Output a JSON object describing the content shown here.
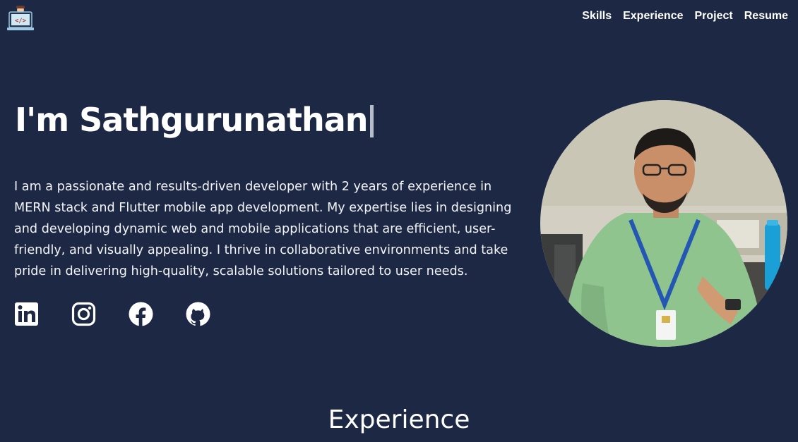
{
  "nav": {
    "items": [
      {
        "label": "Skills"
      },
      {
        "label": "Experience"
      },
      {
        "label": "Project"
      },
      {
        "label": "Resume"
      }
    ]
  },
  "hero": {
    "title": "I'm Sathgurunathan",
    "intro": "I am a passionate and results-driven developer with 2 years of experience in MERN stack and Flutter mobile app development. My expertise lies in designing and developing dynamic web and mobile applications that are efficient, user-friendly, and visually appealing. I thrive in collaborative environments and take pride in delivering high-quality, scalable solutions tailored to user needs."
  },
  "socials": [
    {
      "icon": "linkedin-icon"
    },
    {
      "icon": "instagram-icon"
    },
    {
      "icon": "facebook-icon"
    },
    {
      "icon": "github-icon"
    }
  ],
  "sections": {
    "experience_title": "Experience"
  },
  "colors": {
    "background": "#1d2844",
    "text": "#ffffff",
    "cursor": "#b7bdc8"
  }
}
